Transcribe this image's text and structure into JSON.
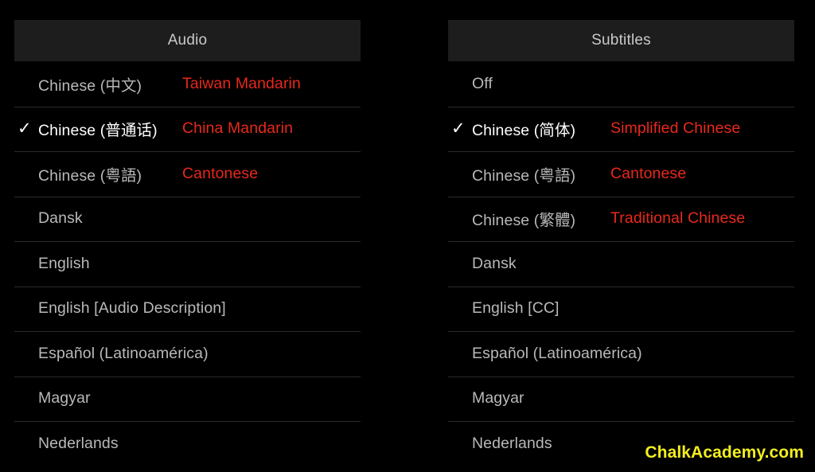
{
  "panels": [
    {
      "id": "audio",
      "title": "Audio",
      "rows": [
        {
          "label": "Chinese (中文)",
          "note": "Taiwan Mandarin",
          "selected": false
        },
        {
          "label": "Chinese (普通话)",
          "note": "China Mandarin",
          "selected": true
        },
        {
          "label": "Chinese (粤語)",
          "note": "Cantonese",
          "selected": false
        },
        {
          "label": "Dansk",
          "note": "",
          "selected": false
        },
        {
          "label": "English",
          "note": "",
          "selected": false
        },
        {
          "label": "English [Audio Description]",
          "note": "",
          "selected": false
        },
        {
          "label": "Español (Latinoamérica)",
          "note": "",
          "selected": false
        },
        {
          "label": "Magyar",
          "note": "",
          "selected": false
        },
        {
          "label": "Nederlands",
          "note": "",
          "selected": false
        }
      ]
    },
    {
      "id": "subtitles",
      "title": "Subtitles",
      "rows": [
        {
          "label": "Off",
          "note": "",
          "selected": false
        },
        {
          "label": "Chinese (简体)",
          "note": "Simplified Chinese",
          "selected": true
        },
        {
          "label": "Chinese (粤語)",
          "note": "Cantonese",
          "selected": false
        },
        {
          "label": "Chinese (繁體)",
          "note": "Traditional Chinese",
          "selected": false
        },
        {
          "label": "Dansk",
          "note": "",
          "selected": false
        },
        {
          "label": "English [CC]",
          "note": "",
          "selected": false
        },
        {
          "label": "Español (Latinoamérica)",
          "note": "",
          "selected": false
        },
        {
          "label": "Magyar",
          "note": "",
          "selected": false
        },
        {
          "label": "Nederlands",
          "note": "",
          "selected": false
        }
      ]
    }
  ],
  "check_glyph": "✓",
  "watermark": {
    "text": "ChalkAcademy.com",
    "color": "#f2ee1e"
  },
  "colors": {
    "background": "#000000",
    "header_background": "#1d1d1d",
    "separator": "#2b2b2b",
    "label": "#b9b9b9",
    "label_selected": "#ffffff",
    "note_red": "#e8281c",
    "title": "#c9c9c9"
  }
}
